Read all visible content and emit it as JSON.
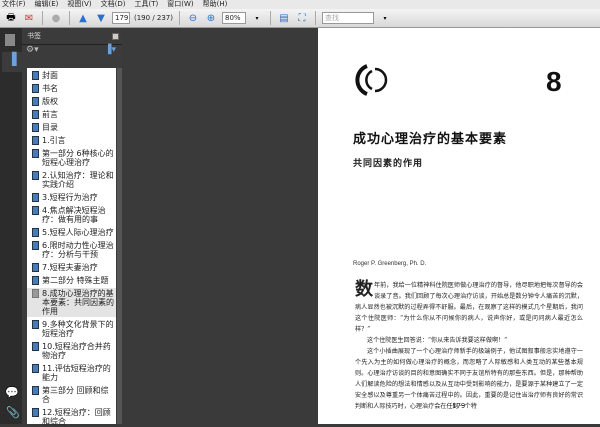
{
  "menu": [
    "文件(F)",
    "编辑(E)",
    "视图(V)",
    "文档(D)",
    "工具(T)",
    "窗口(W)",
    "帮助(H)"
  ],
  "toolbar": {
    "page_input": "179",
    "page_info": "(190 / 237)",
    "zoom": "80%",
    "search_placeholder": "查找"
  },
  "panel": {
    "title": "书签",
    "items": [
      "封面",
      "书名",
      "版权",
      "前言",
      "目录",
      "1.引言",
      "第一部分 6种核心的短程心理治疗",
      "2.认知治疗：理论和实践介绍",
      "3.短程行为治疗",
      "4.焦点解决短程治疗：做有用的事",
      "5.短程人际心理治疗",
      "6.限时动力性心理治疗：分析与干预",
      "7.短程夫妻治疗",
      "第二部分 特殊主题",
      "8.成功心理治疗的基本要素：共同因素的作用",
      "9.多种文化背景下的短程治疗",
      "10.短程治疗合并药物治疗",
      "11.评估短程治疗的能力",
      "第三部分 回顾和综合",
      "12.短程治疗：回顾和综合"
    ],
    "selected_index": 14
  },
  "page": {
    "chapter_number": "8",
    "title": "成功心理治疗的基本要素",
    "subtitle": "共同因素的作用",
    "author": "Roger P. Greenberg, Ph. D.",
    "dropcap": "数",
    "paragraphs": [
      "年前，我给一位精神科住院医师做心理治疗的督导，他尽职地把每次督导的会谈录了音。我们回顾了每次心理治疗访谈，开始总是数分钟令人痛苦的沉默，病人显然也被沉默的过程弄得不舒服。最后，在观察了这样的模式几个星期后，我问这个住院医师：“为什么你从不问候你的病人，说声你好，或是问问病人最近怎么样？”",
      "这个住院医生回答说：“你从来告诉我要这样做啊！”",
      "这个小插曲展现了一个心理治疗师新手的极端例子，他试图叙事般忠实地遵守一个先入为主的如何做心理治疗的概念，而忽略了人际敏感和人类互动的某些基本规则。心理治疗访谈的目的和意图确实不同于友谊所特有的那些东西。但是，那种帮助人们解读危险的想法和情感以及从互动中受到影响的能力，是要源于某种建立了一定安全感以及尊重另一个体痛苦过程中的。因此，重要的是记住当治疗师有良好的常识判断和人际技巧时，心理治疗会在任何一个特"
    ],
    "page_number": "179"
  }
}
